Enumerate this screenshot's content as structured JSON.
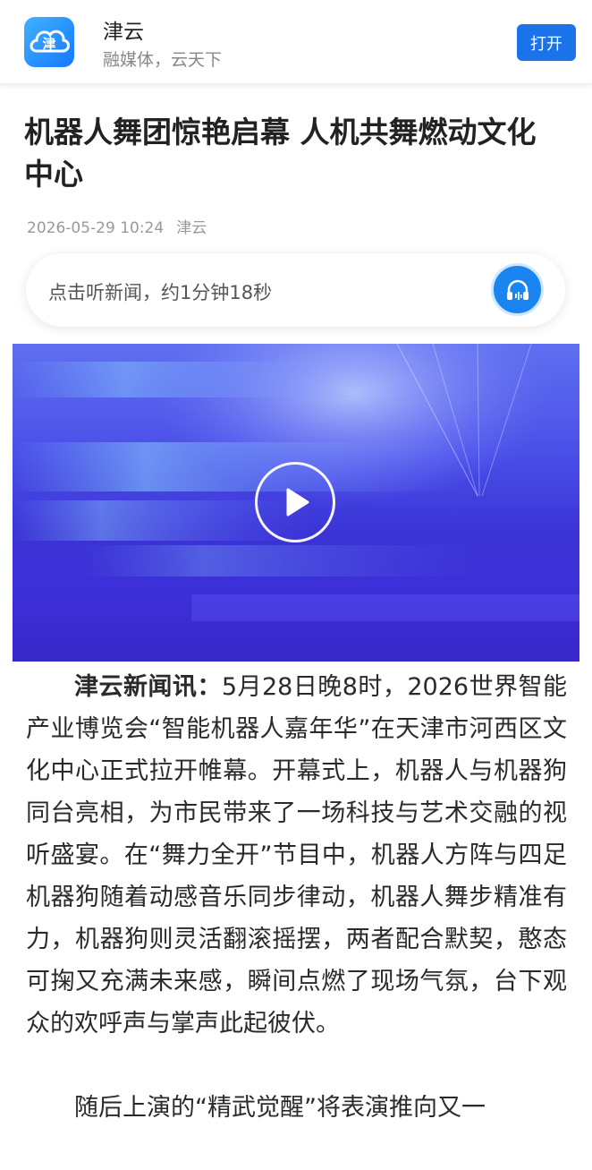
{
  "app_banner": {
    "name": "津云",
    "slogan": "融媒体，云天下",
    "logo_char": "津",
    "open_label": "打开",
    "accent_color": "#1a73e8"
  },
  "article": {
    "title": "机器人舞团惊艳启幕 人机共舞燃动文化中心",
    "date": "2026-05-29 10:24",
    "source": "津云",
    "listen_label": "点击听新闻，约1分钟18秒",
    "paragraphs": [
      {
        "lead": "津云新闻讯：",
        "text": "5月28日晚8时，2026世界智能产业博览会“智能机器人嘉年华”在天津市河西区文化中心正式拉开帷幕。开幕式上，机器人与机器狗同台亮相，为市民带来了一场科技与艺术交融的视听盛宴。在“舞力全开”节目中，机器人方阵与四足机器狗随着动感音乐同步律动，机器人舞步精准有力，机器狗则灵活翻滚摇摆，两者配合默契，憨态可掬又充满未来感，瞬间点燃了现场气氛，台下观众的欢呼声与掌声此起彼伏。"
      },
      {
        "lead": "",
        "text": "随后上演的“精武觉醒”将表演推向又一"
      }
    ]
  },
  "icons": {
    "logo": "cloud-logo-icon",
    "listen": "headphones-icon",
    "play": "play-icon"
  }
}
